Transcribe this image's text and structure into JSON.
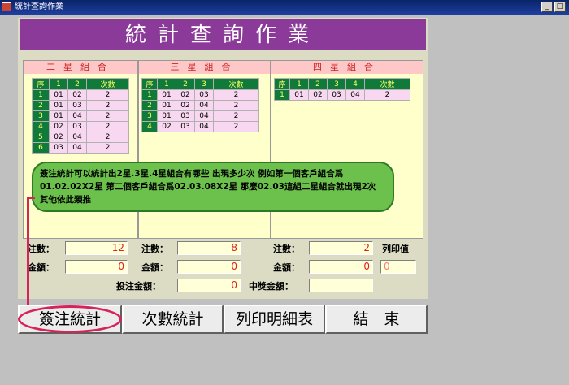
{
  "window": {
    "title": "統計查詢作業"
  },
  "header": {
    "title": "統計查詢作業"
  },
  "panels": [
    {
      "title": "二星組合",
      "columns": [
        "序",
        "1",
        "2",
        "次數"
      ],
      "rows": [
        [
          "1",
          "01",
          "02",
          "2"
        ],
        [
          "2",
          "01",
          "03",
          "2"
        ],
        [
          "3",
          "01",
          "04",
          "2"
        ],
        [
          "4",
          "02",
          "03",
          "2"
        ],
        [
          "5",
          "02",
          "04",
          "2"
        ],
        [
          "6",
          "03",
          "04",
          "2"
        ]
      ]
    },
    {
      "title": "三星組合",
      "columns": [
        "序",
        "1",
        "2",
        "3",
        "次數"
      ],
      "rows": [
        [
          "1",
          "01",
          "02",
          "03",
          "2"
        ],
        [
          "2",
          "01",
          "02",
          "04",
          "2"
        ],
        [
          "3",
          "01",
          "03",
          "04",
          "2"
        ],
        [
          "4",
          "02",
          "03",
          "04",
          "2"
        ]
      ]
    },
    {
      "title": "四星組合",
      "columns": [
        "序",
        "1",
        "2",
        "3",
        "4",
        "次數"
      ],
      "rows": [
        [
          "1",
          "01",
          "02",
          "03",
          "04",
          "2"
        ]
      ]
    }
  ],
  "tooltip": {
    "line1": "簽注統計可以統計出2星.3星.4星組合有哪些 出現多少次 例如第一個客戶組合爲",
    "line2": "01.02.02X2星 第二個客戶組合爲02.03.08X2星 那麼02.03這組二星組合就出現2次",
    "line3": "其他依此類推"
  },
  "stats": {
    "count_label": "注數：",
    "amount_label": "金額：",
    "two": {
      "count": "12",
      "amount": "0"
    },
    "three": {
      "count": "8",
      "amount": "0"
    },
    "four": {
      "count": "2",
      "amount": "0"
    },
    "print_label": "列印值",
    "print_value": "0",
    "bet_total_label": "投注金額：",
    "bet_total": "0",
    "win_total_label": "中獎金額：",
    "win_total": ""
  },
  "buttons": {
    "bet_stats": "簽注統計",
    "count_stats": "次數統計",
    "print_detail": "列印明細表",
    "end": "結　束"
  }
}
